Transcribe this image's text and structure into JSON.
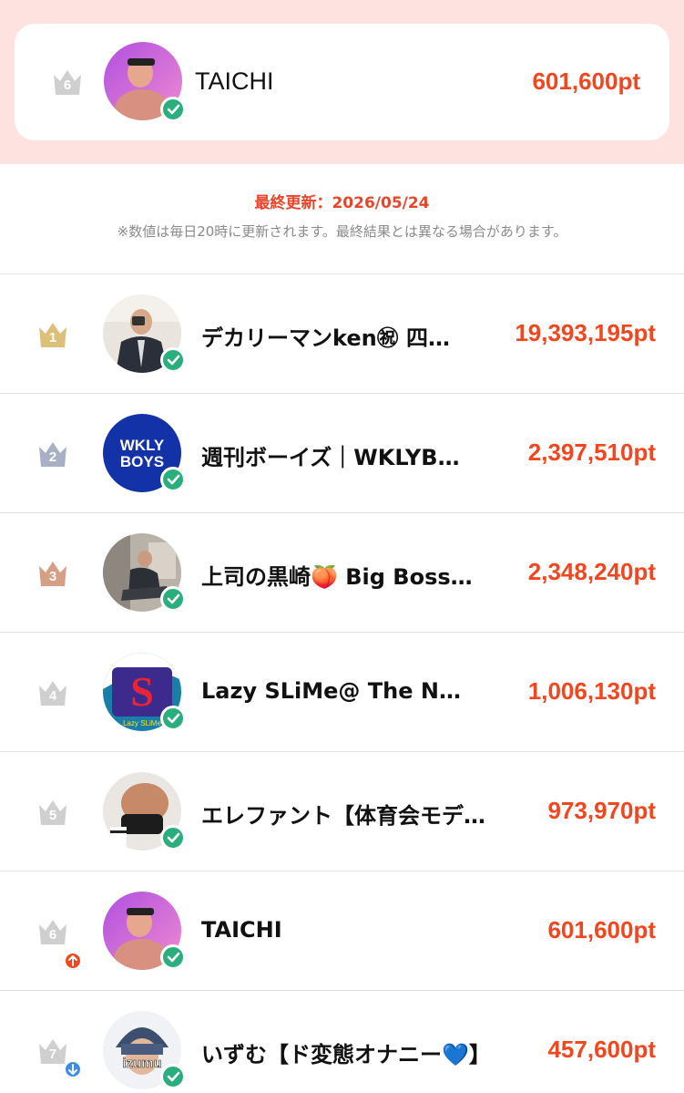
{
  "my_rank": {
    "rank": "6",
    "name": "TAICHI",
    "points": "601,600pt"
  },
  "info": {
    "updated": "最終更新：2026/05/24",
    "note": "※数値は毎日20時に更新されます。最終結果とは異なる場合があります。"
  },
  "colors": {
    "accent": "#f2461f",
    "gold": "#dcc07a",
    "silver": "#a8b0c4",
    "bronze": "#d79e86",
    "gray": "#cfcfcf",
    "verified": "#2bae7e",
    "rank_up": "#f2461f",
    "rank_down": "#3b8ee6"
  },
  "ranking": [
    {
      "rank": "1",
      "name": "デカリーマンken㊗︎ 四…",
      "points": "19,393,195pt",
      "crown": "gold"
    },
    {
      "rank": "2",
      "name": "週刊ボーイズ｜WKLYBO…",
      "points": "2,397,510pt",
      "crown": "silver",
      "avatar_text_1": "WKLY",
      "avatar_text_2": "BOYS"
    },
    {
      "rank": "3",
      "name": "上司の黒崎🍑 Big Boss …",
      "points": "2,348,240pt",
      "crown": "bronze"
    },
    {
      "rank": "4",
      "name": "Lazy SLiMe@ The No. …",
      "points": "1,006,130pt",
      "crown": "gray",
      "avatar_letter": "S",
      "avatar_caption": "Lazy SLiMe"
    },
    {
      "rank": "5",
      "name": "エレファント【体育会モデ…",
      "points": "973,970pt",
      "crown": "gray"
    },
    {
      "rank": "6",
      "name": "TAICHI",
      "points": "601,600pt",
      "crown": "gray",
      "trend": "up",
      "trend_icon": "arrow-up-icon"
    },
    {
      "rank": "7",
      "name": "いずむ【ド変態オナニー💙】",
      "points": "457,600pt",
      "crown": "gray",
      "trend": "down",
      "trend_icon": "arrow-down-icon",
      "avatar_text_1": "izumu"
    }
  ]
}
